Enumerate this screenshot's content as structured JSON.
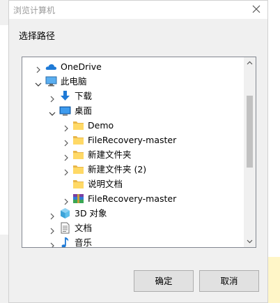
{
  "dialog": {
    "title": "浏览计算机",
    "prompt": "选择路径",
    "ok_label": "确定",
    "cancel_label": "取消"
  },
  "tree": {
    "items": [
      {
        "label": "OneDrive",
        "icon": "cloud-icon",
        "expander": "collapsed"
      },
      {
        "label": "此电脑",
        "icon": "computer-icon",
        "expander": "expanded"
      },
      {
        "label": "下载",
        "icon": "download-arrow-icon",
        "expander": "collapsed"
      },
      {
        "label": "桌面",
        "icon": "desktop-icon",
        "expander": "expanded"
      },
      {
        "label": "Demo",
        "icon": "folder-icon",
        "expander": "collapsed"
      },
      {
        "label": "FileRecovery-master",
        "icon": "folder-icon",
        "expander": "collapsed"
      },
      {
        "label": "新建文件夹",
        "icon": "folder-icon",
        "expander": "collapsed"
      },
      {
        "label": "新建文件夹 (2)",
        "icon": "folder-icon",
        "expander": "collapsed"
      },
      {
        "label": "说明文档",
        "icon": "folder-icon",
        "expander": "none"
      },
      {
        "label": "FileRecovery-master",
        "icon": "archive-icon",
        "expander": "collapsed"
      },
      {
        "label": "3D 对象",
        "icon": "3d-objects-icon",
        "expander": "collapsed"
      },
      {
        "label": "文档",
        "icon": "document-icon",
        "expander": "collapsed"
      },
      {
        "label": "音乐",
        "icon": "music-note-icon",
        "expander": "collapsed"
      }
    ]
  }
}
